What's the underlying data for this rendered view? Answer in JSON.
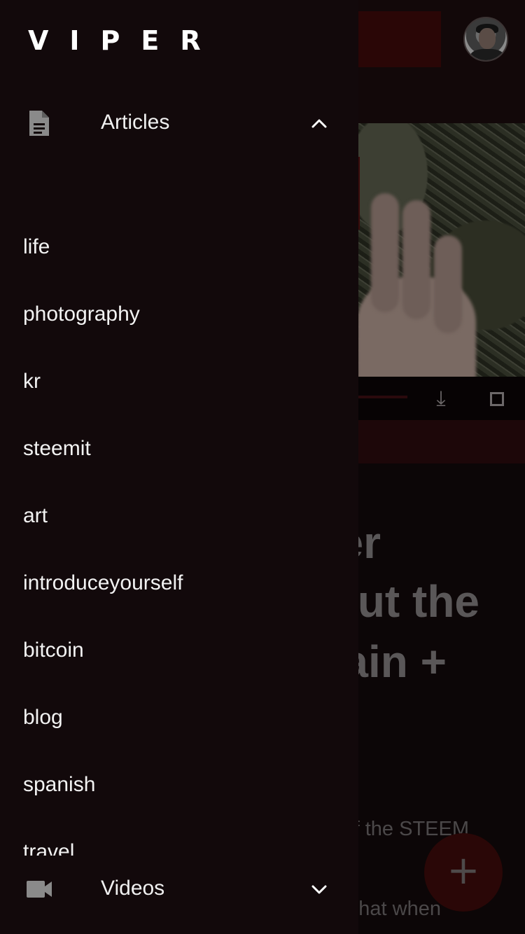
{
  "app": {
    "logo_text": "VIPER"
  },
  "drawer": {
    "articles_section": {
      "label": "Articles",
      "icon": "document-icon",
      "expanded": true,
      "chevron": "chevron-up-icon"
    },
    "tags": [
      "life",
      "photography",
      "kr",
      "steemit",
      "art",
      "introduceyourself",
      "bitcoin",
      "blog",
      "spanish",
      "travel"
    ],
    "videos_section": {
      "label": "Videos",
      "icon": "video-camera-icon",
      "expanded": false,
      "chevron": "chevron-down-icon"
    }
  },
  "background": {
    "title_fragments": [
      "er",
      "ut the",
      "ain +"
    ],
    "body_fragments": [
      "f the STEEM",
      "hat when"
    ],
    "fab_symbol": "+",
    "download_symbol": "⤓"
  },
  "colors": {
    "drawer_bg": "#12090b",
    "text": "#f2f2f2",
    "accent_dark_red": "#2a0707"
  }
}
